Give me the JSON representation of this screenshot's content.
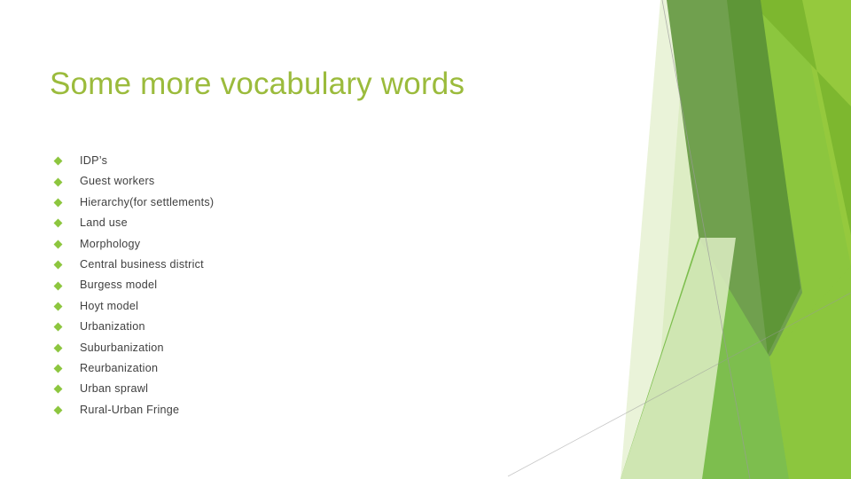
{
  "slide": {
    "title": "Some more vocabulary words",
    "background_color": "#FFFFFF",
    "title_color": "#9BBB3C",
    "body_text_color": "#404040",
    "bullet_marker_color": "#8DC63F",
    "bullet_marker_shape": "diamond"
  },
  "bullets": [
    {
      "label": "IDP’s"
    },
    {
      "label": "Guest workers"
    },
    {
      "label": "Hierarchy(for settlements)"
    },
    {
      "label": "Land use"
    },
    {
      "label": "Morphology"
    },
    {
      "label": "Central business district"
    },
    {
      "label": "Burgess model"
    },
    {
      "label": "Hoyt model"
    },
    {
      "label": "Urbanization"
    },
    {
      "label": "Suburbanization"
    },
    {
      "label": "Reurbanization"
    },
    {
      "label": "Urban sprawl"
    },
    {
      "label": "Rural-Urban Fringe"
    }
  ],
  "decoration": {
    "name": "facet-green-polygons",
    "colors": {
      "olive_green": "#70A04E",
      "dark_green": "#5E9637",
      "vivid_green": "#7DB72F",
      "bright_green": "#8CC63E",
      "light_green": "#95C93D",
      "pale_green": "#C9E3A3",
      "very_pale_green": "#DDEDC4",
      "faint_green": "#EAF3D9",
      "hairline_gray": "#9A9A9A"
    }
  }
}
